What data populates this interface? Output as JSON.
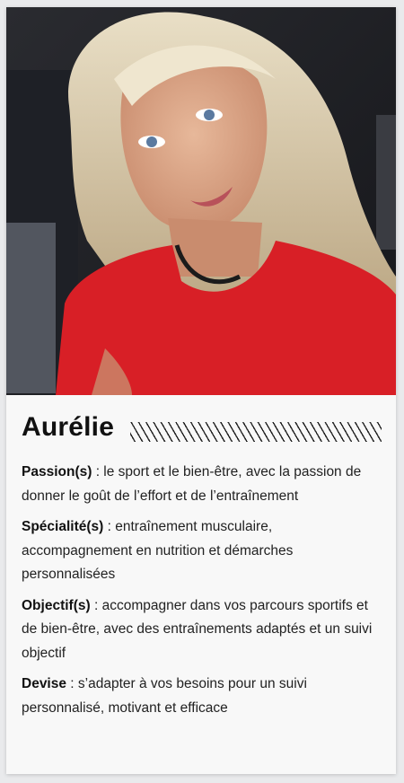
{
  "profile": {
    "name": "Aurélie",
    "photo_alt": "Aurélie",
    "items": [
      {
        "label": "Passion(s)",
        "text": " : le sport et le bien-être, avec la passion de donner le goût de l’effort et de l’entraînement"
      },
      {
        "label": "Spécialité(s)",
        "text": " : entraînement musculaire, accompagnement en nutrition et démarches personnalisées"
      },
      {
        "label": "Objectif(s)",
        "text": " : accompagner dans vos parcours sportifs et de bien-être, avec des entraînements adaptés et un suivi objectif"
      },
      {
        "label": "Devise",
        "text": " : s’adapter à vos besoins pour un suivi personnalisé, motivant et efficace"
      }
    ]
  },
  "colors": {
    "card_background": "#f8f8f8",
    "page_background": "#e9eaec",
    "text": "#222222",
    "shirt_red": "#d81f26"
  }
}
